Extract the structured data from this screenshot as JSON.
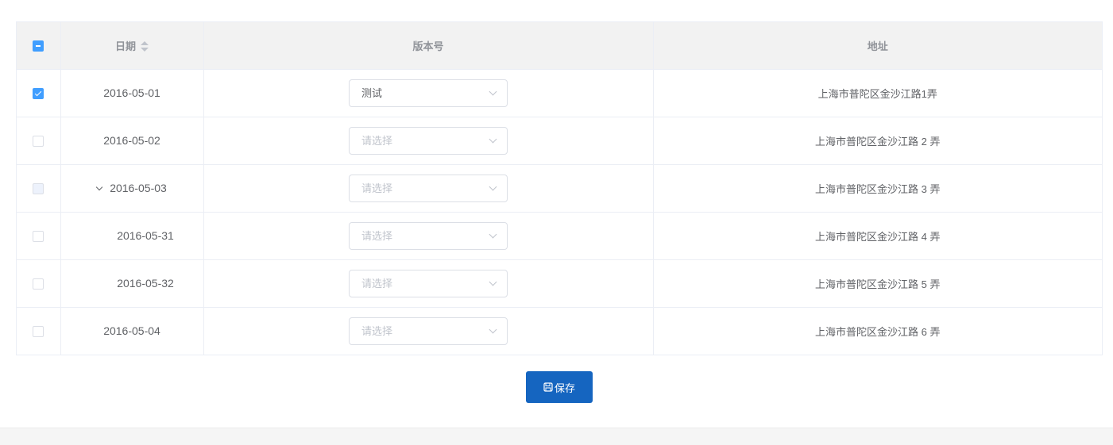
{
  "table": {
    "columns": {
      "date": "日期",
      "version": "版本号",
      "address": "地址"
    },
    "rows": [
      {
        "date": "2016-05-01",
        "version": "测试",
        "version_placeholder": false,
        "address": "上海市普陀区金沙江路1弄",
        "checkbox": "checked"
      },
      {
        "date": "2016-05-02",
        "version": "请选择",
        "version_placeholder": true,
        "address": "上海市普陀区金沙江路 2 弄",
        "checkbox": "unchecked"
      },
      {
        "date": "2016-05-03",
        "version": "请选择",
        "version_placeholder": true,
        "address": "上海市普陀区金沙江路 3 弄",
        "checkbox": "disabled",
        "expanded": true
      },
      {
        "date": "2016-05-31",
        "version": "请选择",
        "version_placeholder": true,
        "address": "上海市普陀区金沙江路 4 弄",
        "checkbox": "unchecked",
        "child": true
      },
      {
        "date": "2016-05-32",
        "version": "请选择",
        "version_placeholder": true,
        "address": "上海市普陀区金沙江路 5 弄",
        "checkbox": "unchecked",
        "child": true
      },
      {
        "date": "2016-05-04",
        "version": "请选择",
        "version_placeholder": true,
        "address": "上海市普陀区金沙江路 6 弄",
        "checkbox": "unchecked"
      }
    ]
  },
  "actions": {
    "save_label": "保存",
    "save_icon": "save-icon"
  },
  "colors": {
    "primary_button": "#1565c0",
    "checkbox_accent": "#409eff",
    "header_bg": "#f2f2f2"
  }
}
